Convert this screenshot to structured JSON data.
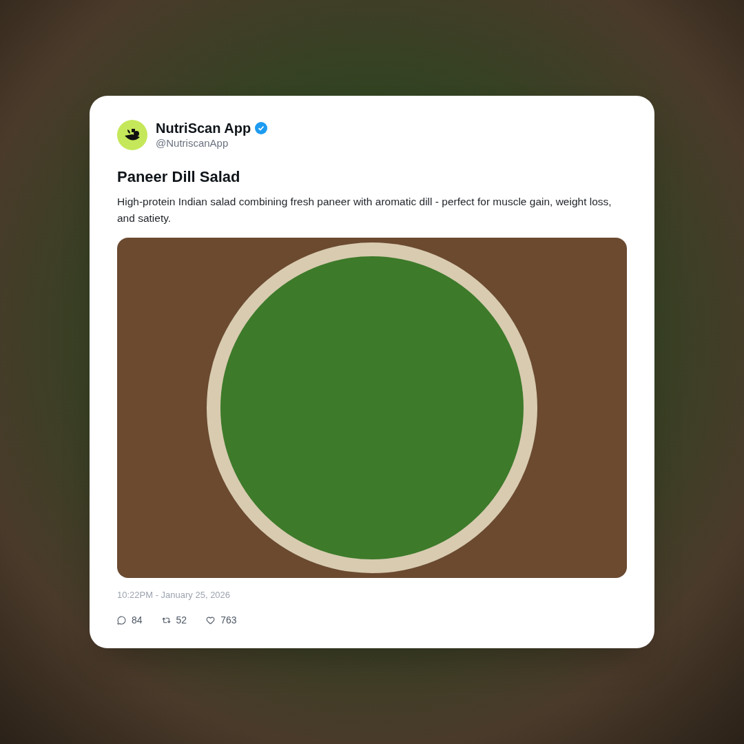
{
  "author": {
    "name": "NutriScan App",
    "verified": true,
    "handle": "@NutriscanApp"
  },
  "post": {
    "title": "Paneer Dill Salad",
    "text": "High-protein Indian salad combining fresh paneer with aromatic dill - perfect for muscle gain, weight loss, and satiety.",
    "timestamp": "10:22PM - January 25, 2026"
  },
  "stats": [
    {
      "kind": "reply",
      "count": "84"
    },
    {
      "kind": "repost",
      "count": "52"
    },
    {
      "kind": "like",
      "count": "763"
    }
  ]
}
